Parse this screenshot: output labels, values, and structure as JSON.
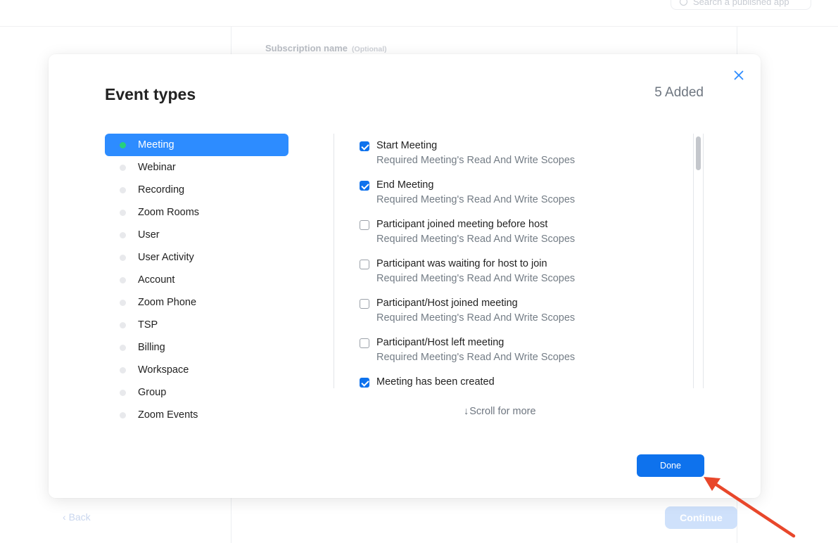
{
  "background": {
    "search_placeholder": "Search a published app",
    "subscription_label": "Subscription name",
    "subscription_optional": "(Optional)",
    "back_label": "Back",
    "continue_label": "Continue"
  },
  "modal": {
    "title": "Event types",
    "added_count": "5 Added",
    "close_icon": "close-icon",
    "categories": [
      {
        "label": "Meeting",
        "active": true
      },
      {
        "label": "Webinar",
        "active": false
      },
      {
        "label": "Recording",
        "active": false
      },
      {
        "label": "Zoom Rooms",
        "active": false
      },
      {
        "label": "User",
        "active": false
      },
      {
        "label": "User Activity",
        "active": false
      },
      {
        "label": "Account",
        "active": false
      },
      {
        "label": "Zoom Phone",
        "active": false
      },
      {
        "label": "TSP",
        "active": false
      },
      {
        "label": "Billing",
        "active": false
      },
      {
        "label": "Workspace",
        "active": false
      },
      {
        "label": "Group",
        "active": false
      },
      {
        "label": "Zoom Events",
        "active": false
      }
    ],
    "events": [
      {
        "name": "Start Meeting",
        "desc": "Required Meeting's Read And Write Scopes",
        "checked": true
      },
      {
        "name": "End Meeting",
        "desc": "Required Meeting's Read And Write Scopes",
        "checked": true
      },
      {
        "name": "Participant joined meeting before host",
        "desc": "Required Meeting's Read And Write Scopes",
        "checked": false
      },
      {
        "name": "Participant was waiting for host to join",
        "desc": "Required Meeting's Read And Write Scopes",
        "checked": false
      },
      {
        "name": "Participant/Host joined meeting",
        "desc": "Required Meeting's Read And Write Scopes",
        "checked": false
      },
      {
        "name": "Participant/Host left meeting",
        "desc": "Required Meeting's Read And Write Scopes",
        "checked": false
      },
      {
        "name": "Meeting has been created",
        "desc": "",
        "checked": true
      }
    ],
    "scroll_more_label": "Scroll for more",
    "done_label": "Done"
  },
  "colors": {
    "accent": "#0e72ed",
    "active_category": "#2d8cff",
    "active_dot": "#26d07c",
    "annotation_arrow": "#e8472b"
  }
}
